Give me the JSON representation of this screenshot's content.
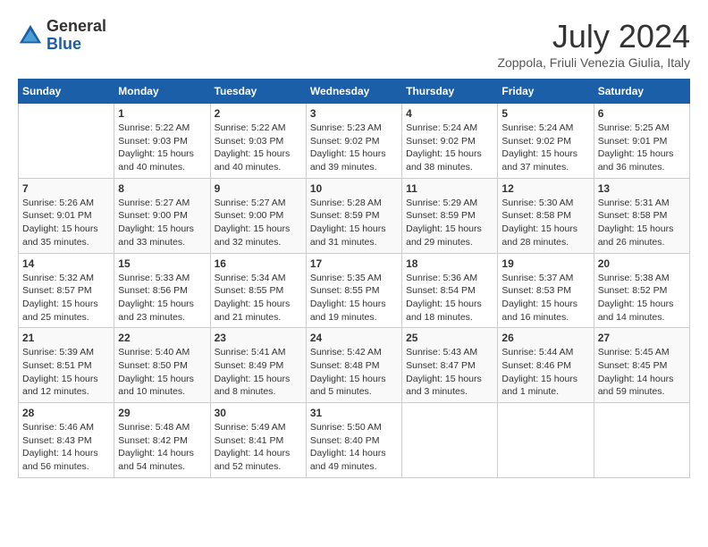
{
  "header": {
    "logo": {
      "general": "General",
      "blue": "Blue"
    },
    "title": "July 2024",
    "location": "Zoppola, Friuli Venezia Giulia, Italy"
  },
  "calendar": {
    "days_of_week": [
      "Sunday",
      "Monday",
      "Tuesday",
      "Wednesday",
      "Thursday",
      "Friday",
      "Saturday"
    ],
    "weeks": [
      [
        {
          "day": "",
          "info": ""
        },
        {
          "day": "1",
          "info": "Sunrise: 5:22 AM\nSunset: 9:03 PM\nDaylight: 15 hours and 40 minutes."
        },
        {
          "day": "2",
          "info": "Sunrise: 5:22 AM\nSunset: 9:03 PM\nDaylight: 15 hours and 40 minutes."
        },
        {
          "day": "3",
          "info": "Sunrise: 5:23 AM\nSunset: 9:02 PM\nDaylight: 15 hours and 39 minutes."
        },
        {
          "day": "4",
          "info": "Sunrise: 5:24 AM\nSunset: 9:02 PM\nDaylight: 15 hours and 38 minutes."
        },
        {
          "day": "5",
          "info": "Sunrise: 5:24 AM\nSunset: 9:02 PM\nDaylight: 15 hours and 37 minutes."
        },
        {
          "day": "6",
          "info": "Sunrise: 5:25 AM\nSunset: 9:01 PM\nDaylight: 15 hours and 36 minutes."
        }
      ],
      [
        {
          "day": "7",
          "info": "Sunrise: 5:26 AM\nSunset: 9:01 PM\nDaylight: 15 hours and 35 minutes."
        },
        {
          "day": "8",
          "info": "Sunrise: 5:27 AM\nSunset: 9:00 PM\nDaylight: 15 hours and 33 minutes."
        },
        {
          "day": "9",
          "info": "Sunrise: 5:27 AM\nSunset: 9:00 PM\nDaylight: 15 hours and 32 minutes."
        },
        {
          "day": "10",
          "info": "Sunrise: 5:28 AM\nSunset: 8:59 PM\nDaylight: 15 hours and 31 minutes."
        },
        {
          "day": "11",
          "info": "Sunrise: 5:29 AM\nSunset: 8:59 PM\nDaylight: 15 hours and 29 minutes."
        },
        {
          "day": "12",
          "info": "Sunrise: 5:30 AM\nSunset: 8:58 PM\nDaylight: 15 hours and 28 minutes."
        },
        {
          "day": "13",
          "info": "Sunrise: 5:31 AM\nSunset: 8:58 PM\nDaylight: 15 hours and 26 minutes."
        }
      ],
      [
        {
          "day": "14",
          "info": "Sunrise: 5:32 AM\nSunset: 8:57 PM\nDaylight: 15 hours and 25 minutes."
        },
        {
          "day": "15",
          "info": "Sunrise: 5:33 AM\nSunset: 8:56 PM\nDaylight: 15 hours and 23 minutes."
        },
        {
          "day": "16",
          "info": "Sunrise: 5:34 AM\nSunset: 8:55 PM\nDaylight: 15 hours and 21 minutes."
        },
        {
          "day": "17",
          "info": "Sunrise: 5:35 AM\nSunset: 8:55 PM\nDaylight: 15 hours and 19 minutes."
        },
        {
          "day": "18",
          "info": "Sunrise: 5:36 AM\nSunset: 8:54 PM\nDaylight: 15 hours and 18 minutes."
        },
        {
          "day": "19",
          "info": "Sunrise: 5:37 AM\nSunset: 8:53 PM\nDaylight: 15 hours and 16 minutes."
        },
        {
          "day": "20",
          "info": "Sunrise: 5:38 AM\nSunset: 8:52 PM\nDaylight: 15 hours and 14 minutes."
        }
      ],
      [
        {
          "day": "21",
          "info": "Sunrise: 5:39 AM\nSunset: 8:51 PM\nDaylight: 15 hours and 12 minutes."
        },
        {
          "day": "22",
          "info": "Sunrise: 5:40 AM\nSunset: 8:50 PM\nDaylight: 15 hours and 10 minutes."
        },
        {
          "day": "23",
          "info": "Sunrise: 5:41 AM\nSunset: 8:49 PM\nDaylight: 15 hours and 8 minutes."
        },
        {
          "day": "24",
          "info": "Sunrise: 5:42 AM\nSunset: 8:48 PM\nDaylight: 15 hours and 5 minutes."
        },
        {
          "day": "25",
          "info": "Sunrise: 5:43 AM\nSunset: 8:47 PM\nDaylight: 15 hours and 3 minutes."
        },
        {
          "day": "26",
          "info": "Sunrise: 5:44 AM\nSunset: 8:46 PM\nDaylight: 15 hours and 1 minute."
        },
        {
          "day": "27",
          "info": "Sunrise: 5:45 AM\nSunset: 8:45 PM\nDaylight: 14 hours and 59 minutes."
        }
      ],
      [
        {
          "day": "28",
          "info": "Sunrise: 5:46 AM\nSunset: 8:43 PM\nDaylight: 14 hours and 56 minutes."
        },
        {
          "day": "29",
          "info": "Sunrise: 5:48 AM\nSunset: 8:42 PM\nDaylight: 14 hours and 54 minutes."
        },
        {
          "day": "30",
          "info": "Sunrise: 5:49 AM\nSunset: 8:41 PM\nDaylight: 14 hours and 52 minutes."
        },
        {
          "day": "31",
          "info": "Sunrise: 5:50 AM\nSunset: 8:40 PM\nDaylight: 14 hours and 49 minutes."
        },
        {
          "day": "",
          "info": ""
        },
        {
          "day": "",
          "info": ""
        },
        {
          "day": "",
          "info": ""
        }
      ]
    ]
  }
}
